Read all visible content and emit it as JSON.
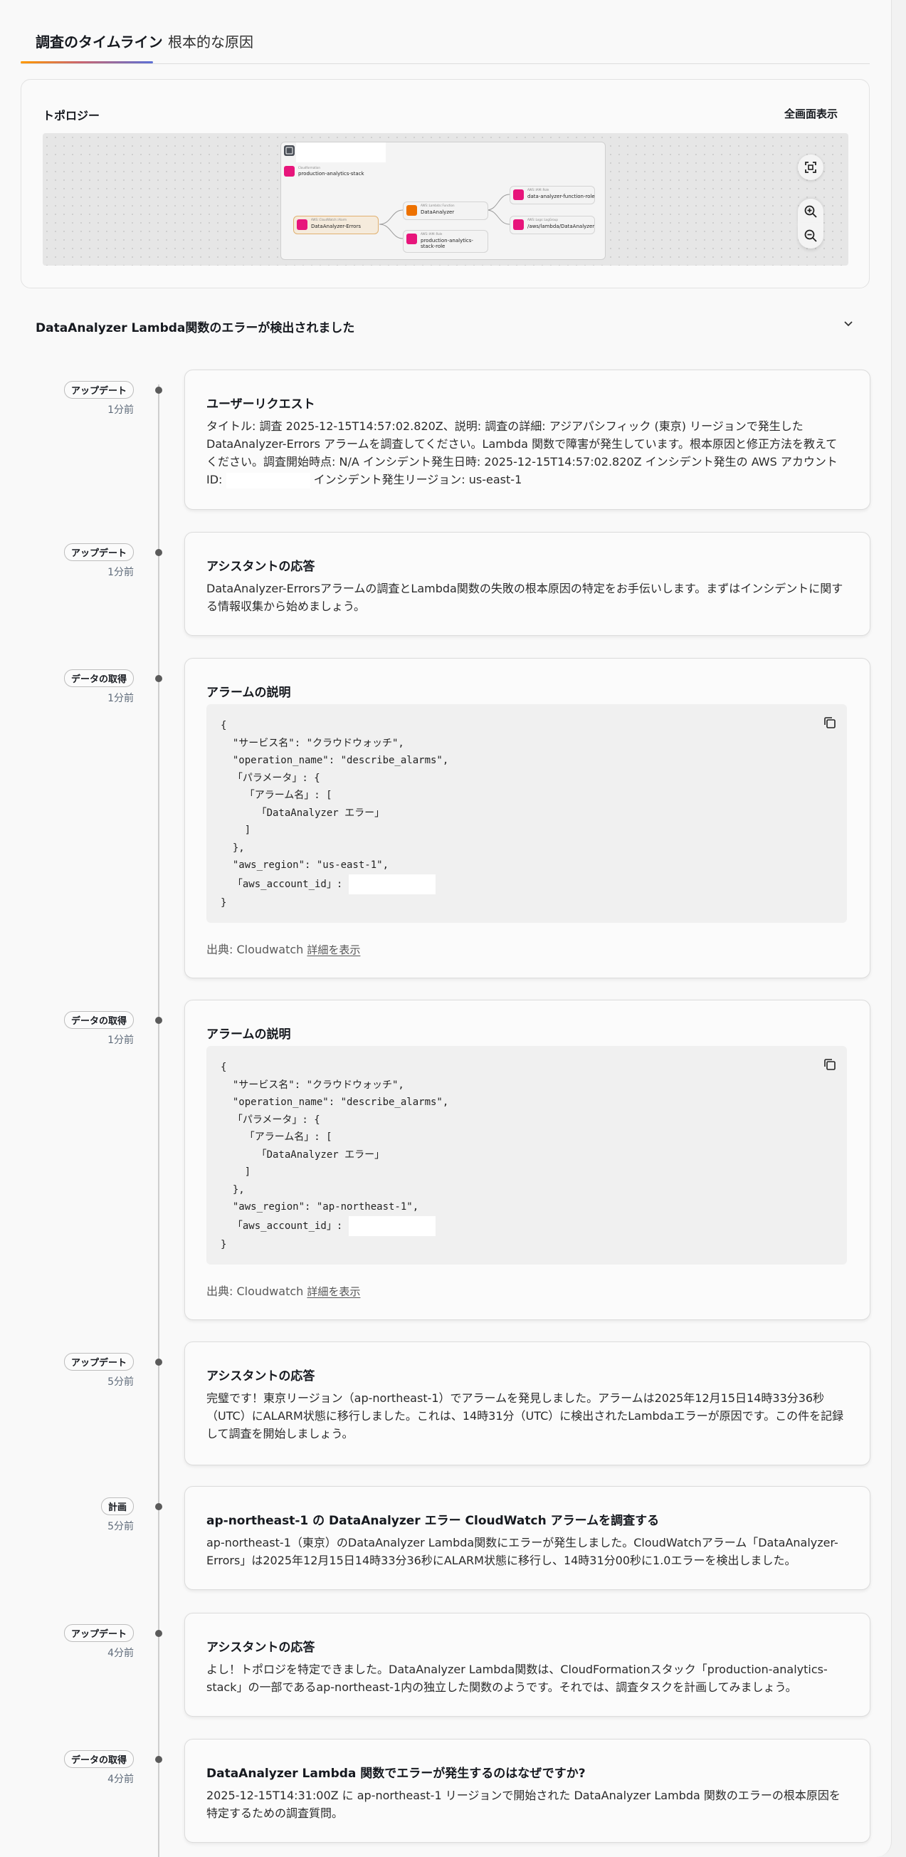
{
  "tabs": [
    {
      "label": "調査のタイムライン",
      "active": true
    },
    {
      "label": "根本的な原因",
      "active": false
    }
  ],
  "topology": {
    "title": "トポロジー",
    "fullscreen_label": "全画面表示",
    "stack_sub": "Cloudformation",
    "stack_name": "production-analytics-stack",
    "nodes": {
      "alarm": {
        "sub": "AWS::CloudWatch::Alarm",
        "name": "DataAnalyzer-Errors"
      },
      "lambda": {
        "sub": "AWS::Lambda::Function",
        "name": "DataAnalyzer"
      },
      "role": {
        "sub": "AWS::IAM::Role",
        "name": "production-analytics-stack-role"
      },
      "log": {
        "sub": "AWS::Logs::LogGroup",
        "name": "/aws/lambda/DataAnalyzer"
      },
      "kinesis": {
        "sub": "AWS::IAM::Role",
        "name": "data-analyzer-function-role"
      }
    },
    "controls": [
      "fit-view",
      "zoom-in",
      "zoom-out"
    ]
  },
  "section_title": "DataAnalyzer Lambda関数のエラーが検出されました",
  "timeline": [
    {
      "badge": "アップデート",
      "time": "1分前",
      "title": "ユーザーリクエスト",
      "body_pre": "タイトル: 調査 2025-12-15T14:57:02.820Z、説明: 調査の詳細: アジアパシフィック (東京) リージョンで発生した DataAnalyzer-Errors アラームを調査してください。Lambda 関数で障害が発生しています。根本原因と修正方法を教えてください。調査開始時点: N/A インシデント発生日時: 2025-12-15T14:57:02.820Z インシデント発生の AWS アカウント ID:",
      "body_post": "インシデント発生リージョン: us-east-1"
    },
    {
      "badge": "アップデート",
      "time": "1分前",
      "title": "アシスタントの応答",
      "body": "DataAnalyzer-Errorsアラームの調査とLambda関数の失敗の根本原因の特定をお手伝いします。まずはインシデントに関する情報収集から始めましょう。"
    },
    {
      "badge": "データの取得",
      "time": "1分前",
      "title": "アラームの説明",
      "code": "{\n  \"サービス名\": \"クラウドウォッチ\",\n  \"operation_name\": \"describe_alarms\",\n  「パラメータ」: {\n    「アラーム名」: [\n      「DataAnalyzer エラー」\n    ]\n  },\n  \"aws_region\": \"us-east-1\",\n  「aws_account_id」: ",
      "code_end": "}",
      "source_prefix": "出典: Cloudwatch",
      "details_link": "詳細を表示"
    },
    {
      "badge": "データの取得",
      "time": "1分前",
      "title": "アラームの説明",
      "code": "{\n  \"サービス名\": \"クラウドウォッチ\",\n  \"operation_name\": \"describe_alarms\",\n  「パラメータ」: {\n    「アラーム名」: [\n      「DataAnalyzer エラー」\n    ]\n  },\n  \"aws_region\": \"ap-northeast-1\",\n  「aws_account_id」: ",
      "code_end": "}",
      "source_prefix": "出典: Cloudwatch",
      "details_link": "詳細を表示"
    },
    {
      "badge": "アップデート",
      "time": "5分前",
      "title": "アシスタントの応答",
      "body": "完璧です！東京リージョン（ap-northeast-1）でアラームを発見しました。アラームは2025年12月15日14時33分36秒（UTC）にALARM状態に移行しました。これは、14時31分（UTC）に検出されたLambdaエラーが原因です。この件を記録して調査を開始しましょう。"
    },
    {
      "badge": "計画",
      "time": "5分前",
      "title": "ap-northeast-1 の DataAnalyzer エラー CloudWatch アラームを調査する",
      "body": "ap-northeast-1（東京）のDataAnalyzer Lambda関数にエラーが発生しました。CloudWatchアラーム「DataAnalyzer-Errors」は2025年12月15日14時33分36秒にALARM状態に移行し、14時31分00秒に1.0エラーを検出しました。"
    },
    {
      "badge": "アップデート",
      "time": "4分前",
      "title": "アシスタントの応答",
      "body": "よし！トポロジを特定できました。DataAnalyzer Lambda関数は、CloudFormationスタック「production-analytics-stack」の一部であるap-northeast-1内の独立した関数のようです。それでは、調査タスクを計画してみましょう。"
    },
    {
      "badge": "データの取得",
      "time": "4分前",
      "title": "DataAnalyzer Lambda 関数でエラーが発生するのはなぜですか?",
      "body": "2025-12-15T14:31:00Z に ap-northeast-1 リージョンで開始された DataAnalyzer Lambda 関数のエラーの根本原因を特定するための調査質問。"
    }
  ],
  "colors": {
    "accent_gradient": [
      "#ff9900",
      "#c9656f",
      "#5b6fd6"
    ],
    "alarm_icon": "#e7157b",
    "lambda_icon": "#ed7100"
  }
}
